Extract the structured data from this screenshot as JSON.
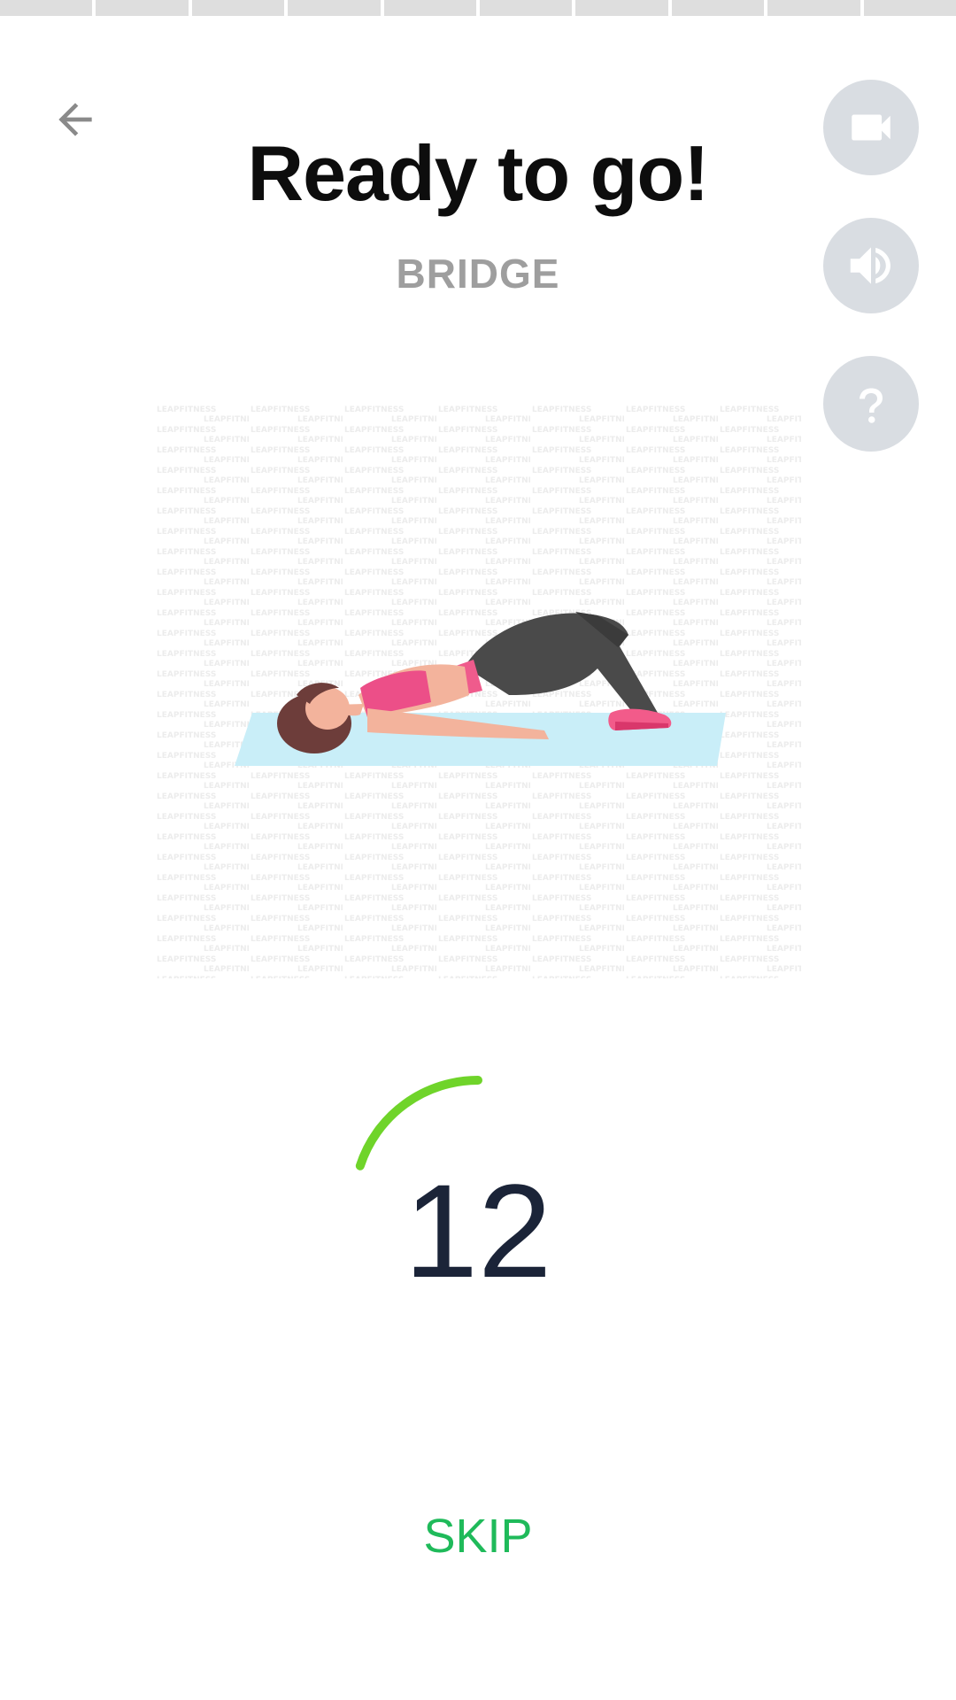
{
  "progress": {
    "segments_total": 10,
    "segments_completed": 0
  },
  "header": {
    "title": "Ready to go!",
    "exercise_name": "BRIDGE"
  },
  "actions": {
    "video_icon": "video-camera-icon",
    "sound_icon": "speaker-icon",
    "help_icon": "question-mark-icon"
  },
  "illustration": {
    "watermark_text": "LEAPFITNESS",
    "mat_color": "#c9eef8"
  },
  "countdown": {
    "value": "12",
    "arc_fraction": 0.2,
    "arc_color": "#6fd42a"
  },
  "footer": {
    "skip_label": "SKIP"
  },
  "colors": {
    "accent_green": "#1fba5a",
    "button_bg": "#d9dde2",
    "title": "#0d0d0d",
    "subtitle": "#9e9e9e"
  }
}
